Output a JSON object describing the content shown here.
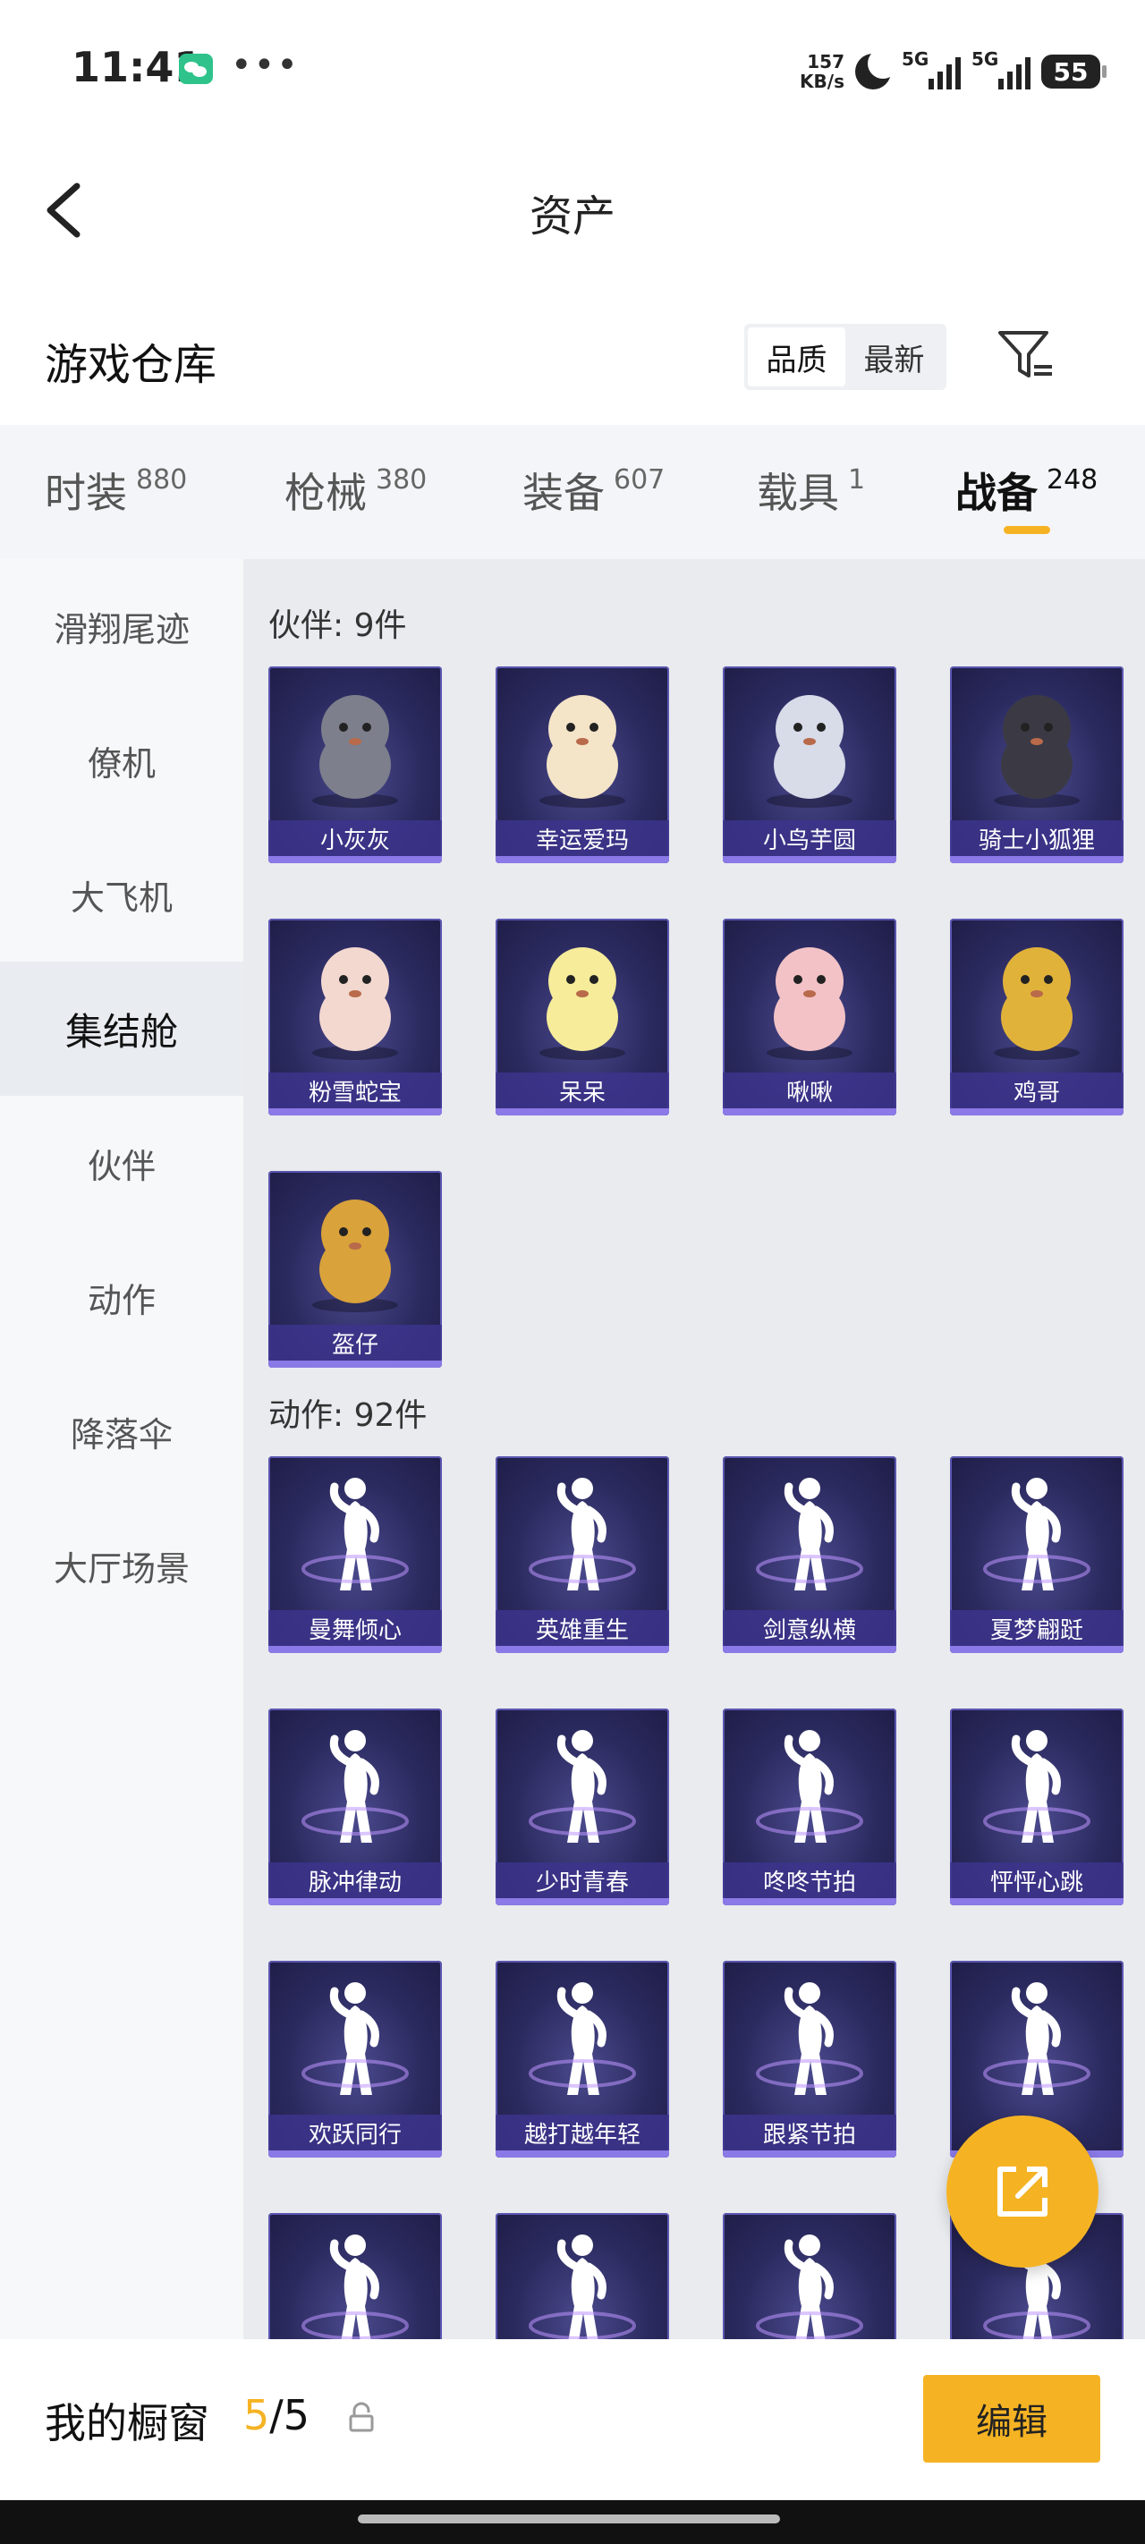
{
  "status_bar": {
    "time": "11:41",
    "speed_value": "157",
    "speed_unit": "KB/s",
    "signal1": "5G",
    "signal2": "5G",
    "battery": "55"
  },
  "header": {
    "title": "资产"
  },
  "warehouse": {
    "title": "游戏仓库",
    "sort_options": [
      "品质",
      "最新"
    ]
  },
  "category_tabs": [
    {
      "name": "时装",
      "count": "880"
    },
    {
      "name": "枪械",
      "count": "380"
    },
    {
      "name": "装备",
      "count": "607"
    },
    {
      "name": "载具",
      "count": "1"
    },
    {
      "name": "战备",
      "count": "248"
    }
  ],
  "sidebar": {
    "items": [
      "滑翔尾迹",
      "僚机",
      "大飞机",
      "集结舱",
      "伙伴",
      "动作",
      "降落伞",
      "大厅场景"
    ],
    "active": "集结舱"
  },
  "sections": {
    "companions": {
      "title": "伙伴: 9件",
      "items": [
        "小灰灰",
        "幸运爱玛",
        "小鸟芋圆",
        "骑士小狐狸",
        "粉雪蛇宝",
        "呆呆",
        "啾啾",
        "鸡哥",
        "盔仔"
      ]
    },
    "actions": {
      "title": "动作: 92件",
      "items": [
        "曼舞倾心",
        "英雄重生",
        "剑意纵横",
        "夏梦翩跹",
        "脉冲律动",
        "少时青春",
        "咚咚节拍",
        "怦怦心跳",
        "欢跃同行",
        "越打越年轻",
        "跟紧节拍",
        "",
        "",
        "",
        "",
        ""
      ]
    }
  },
  "showcase": {
    "label": "我的橱窗",
    "current": "5",
    "total": "/5",
    "edit_label": "编辑"
  },
  "colors": {
    "accent": "#f5b324",
    "card_bg": "#2b2a5f",
    "card_caption": "#3c348c"
  }
}
